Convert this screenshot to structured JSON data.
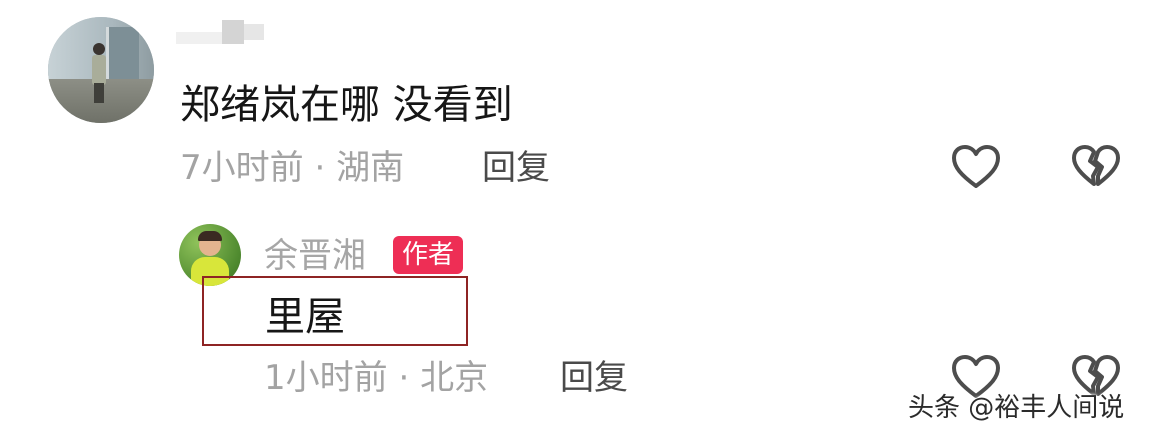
{
  "comment": {
    "username": "",
    "text": "郑绪岚在哪 没看到",
    "time": "7小时前",
    "separator": "·",
    "location": "湖南",
    "reply_label": "回复",
    "like_icon": "heart-outline-icon",
    "dislike_icon": "broken-heart-icon"
  },
  "reply": {
    "username": "余晋湘",
    "badge": "作者",
    "text": "里屋",
    "time": "1小时前",
    "separator": "·",
    "location": "北京",
    "reply_label": "回复",
    "like_icon": "heart-outline-icon",
    "dislike_icon": "broken-heart-icon"
  },
  "watermark": "头条 @裕丰人间说",
  "colors": {
    "badge_bg": "#ee2e55",
    "meta_text": "#a3a3a3",
    "primary_text": "#161616",
    "highlight_border": "#8e2424",
    "icon_stroke": "#4d4d4d"
  }
}
